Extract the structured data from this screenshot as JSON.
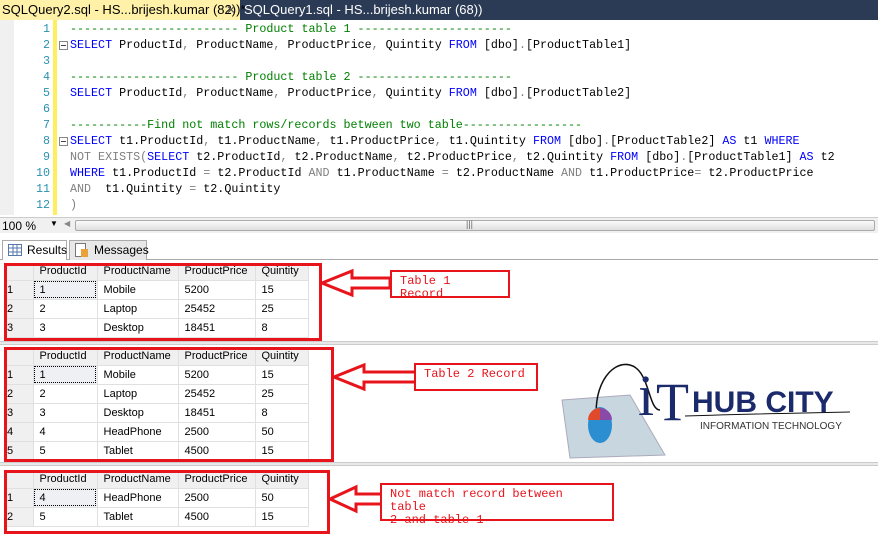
{
  "tabs": [
    {
      "label": "SQLQuery2.sql - HS...brijesh.kumar (82))*",
      "active": true
    },
    {
      "label": "SQLQuery1.sql - HS...brijesh.kumar (68))",
      "active": false
    }
  ],
  "editor": {
    "lines": [
      {
        "n": "1",
        "parts": [
          [
            "cm",
            "------------------------ Product table 1 ----------------------"
          ]
        ]
      },
      {
        "n": "2",
        "fold": true,
        "parts": [
          [
            "kw",
            "SELECT"
          ],
          [
            "",
            "ProductId"
          ],
          [
            "gr",
            ", "
          ],
          [
            "",
            "ProductName"
          ],
          [
            "gr",
            ", "
          ],
          [
            "",
            "ProductPrice"
          ],
          [
            "gr",
            ", "
          ],
          [
            "",
            "Quintity "
          ],
          [
            "kw",
            "FROM"
          ],
          [
            "",
            "[dbo]"
          ],
          [
            "gr",
            "."
          ],
          [
            "",
            "[ProductTable1]"
          ]
        ]
      },
      {
        "n": "3",
        "parts": []
      },
      {
        "n": "4",
        "parts": [
          [
            "cm",
            "------------------------ Product table 2 ----------------------"
          ]
        ]
      },
      {
        "n": "5",
        "parts": [
          [
            "kw",
            "SELECT"
          ],
          [
            "",
            "ProductId"
          ],
          [
            "gr",
            ", "
          ],
          [
            "",
            "ProductName"
          ],
          [
            "gr",
            ", "
          ],
          [
            "",
            "ProductPrice"
          ],
          [
            "gr",
            ", "
          ],
          [
            "",
            "Quintity "
          ],
          [
            "kw",
            "FROM"
          ],
          [
            "",
            "[dbo]"
          ],
          [
            "gr",
            "."
          ],
          [
            "",
            "[ProductTable2]"
          ]
        ]
      },
      {
        "n": "6",
        "parts": []
      },
      {
        "n": "7",
        "parts": [
          [
            "cm",
            "-----------Find not match rows/records between two table-----------------"
          ]
        ]
      },
      {
        "n": "8",
        "fold": true,
        "parts": [
          [
            "kw",
            "SELECT"
          ],
          [
            "",
            "t1.ProductId"
          ],
          [
            "gr",
            ", "
          ],
          [
            "",
            "t1.ProductName"
          ],
          [
            "gr",
            ", "
          ],
          [
            "",
            "t1.ProductPrice"
          ],
          [
            "gr",
            ", "
          ],
          [
            "",
            "t1.Quintity "
          ],
          [
            "kw",
            "FROM"
          ],
          [
            "",
            "[dbo]"
          ],
          [
            "gr",
            "."
          ],
          [
            "",
            "[ProductTable2] "
          ],
          [
            "kw",
            "AS"
          ],
          [
            "",
            "t1 "
          ],
          [
            "kw",
            "WHERE"
          ]
        ]
      },
      {
        "n": "9",
        "parts": [
          [
            "gr",
            "NOT EXISTS("
          ],
          [
            "kw",
            "SELECT"
          ],
          [
            "",
            "t2.ProductId"
          ],
          [
            "gr",
            ", "
          ],
          [
            "",
            "t2.ProductName"
          ],
          [
            "gr",
            ", "
          ],
          [
            "",
            "t2.ProductPrice"
          ],
          [
            "gr",
            ", "
          ],
          [
            "",
            "t2.Quintity "
          ],
          [
            "kw",
            "FROM"
          ],
          [
            "",
            "[dbo]"
          ],
          [
            "gr",
            "."
          ],
          [
            "",
            "[ProductTable1] "
          ],
          [
            "kw",
            "AS"
          ],
          [
            "",
            "t2"
          ]
        ]
      },
      {
        "n": "10",
        "parts": [
          [
            "kw",
            "WHERE"
          ],
          [
            "",
            "t1.ProductId "
          ],
          [
            "gr",
            "= "
          ],
          [
            "",
            "t2.ProductId "
          ],
          [
            "gr",
            "AND "
          ],
          [
            "",
            "t1.ProductName "
          ],
          [
            "gr",
            "= "
          ],
          [
            "",
            "t2.ProductName "
          ],
          [
            "gr",
            "AND "
          ],
          [
            "",
            "t1.ProductPrice"
          ],
          [
            "gr",
            "= "
          ],
          [
            "",
            "t2.ProductPrice"
          ]
        ]
      },
      {
        "n": "11",
        "parts": [
          [
            "gr",
            "AND  "
          ],
          [
            "",
            "t1.Quintity "
          ],
          [
            "gr",
            "= "
          ],
          [
            "",
            "t2.Quintity"
          ]
        ]
      },
      {
        "n": "12",
        "parts": [
          [
            "gr",
            ")"
          ]
        ]
      }
    ]
  },
  "status": {
    "zoom": "100 %"
  },
  "result_tabs": {
    "results": "Results",
    "messages": "Messages"
  },
  "columns": [
    "ProductId",
    "ProductName",
    "ProductPrice",
    "Quintity"
  ],
  "grids": [
    {
      "rows": [
        [
          "1",
          "1",
          "Mobile",
          "5200",
          "15"
        ],
        [
          "2",
          "2",
          "Laptop",
          "25452",
          "25"
        ],
        [
          "3",
          "3",
          "Desktop",
          "18451",
          "8"
        ]
      ]
    },
    {
      "rows": [
        [
          "1",
          "1",
          "Mobile",
          "5200",
          "15"
        ],
        [
          "2",
          "2",
          "Laptop",
          "25452",
          "25"
        ],
        [
          "3",
          "3",
          "Desktop",
          "18451",
          "8"
        ],
        [
          "4",
          "4",
          "HeadPhone",
          "2500",
          "50"
        ],
        [
          "5",
          "5",
          "Tablet",
          "4500",
          "15"
        ]
      ]
    },
    {
      "rows": [
        [
          "1",
          "4",
          "HeadPhone",
          "2500",
          "50"
        ],
        [
          "2",
          "5",
          "Tablet",
          "4500",
          "15"
        ]
      ]
    }
  ],
  "annotations": {
    "a1": "Table 1 Record",
    "a2": "Table 2 Record",
    "a3_l1": "Not match record between table",
    "a3_l2": "2 and table 1"
  },
  "logo": {
    "brand": "iT HUB CITY",
    "tagline": "INFORMATION TECHNOLOGY"
  },
  "colors": {
    "annotation_red": "#e8141c",
    "keyword": "#0000ff",
    "comment": "#008000"
  }
}
